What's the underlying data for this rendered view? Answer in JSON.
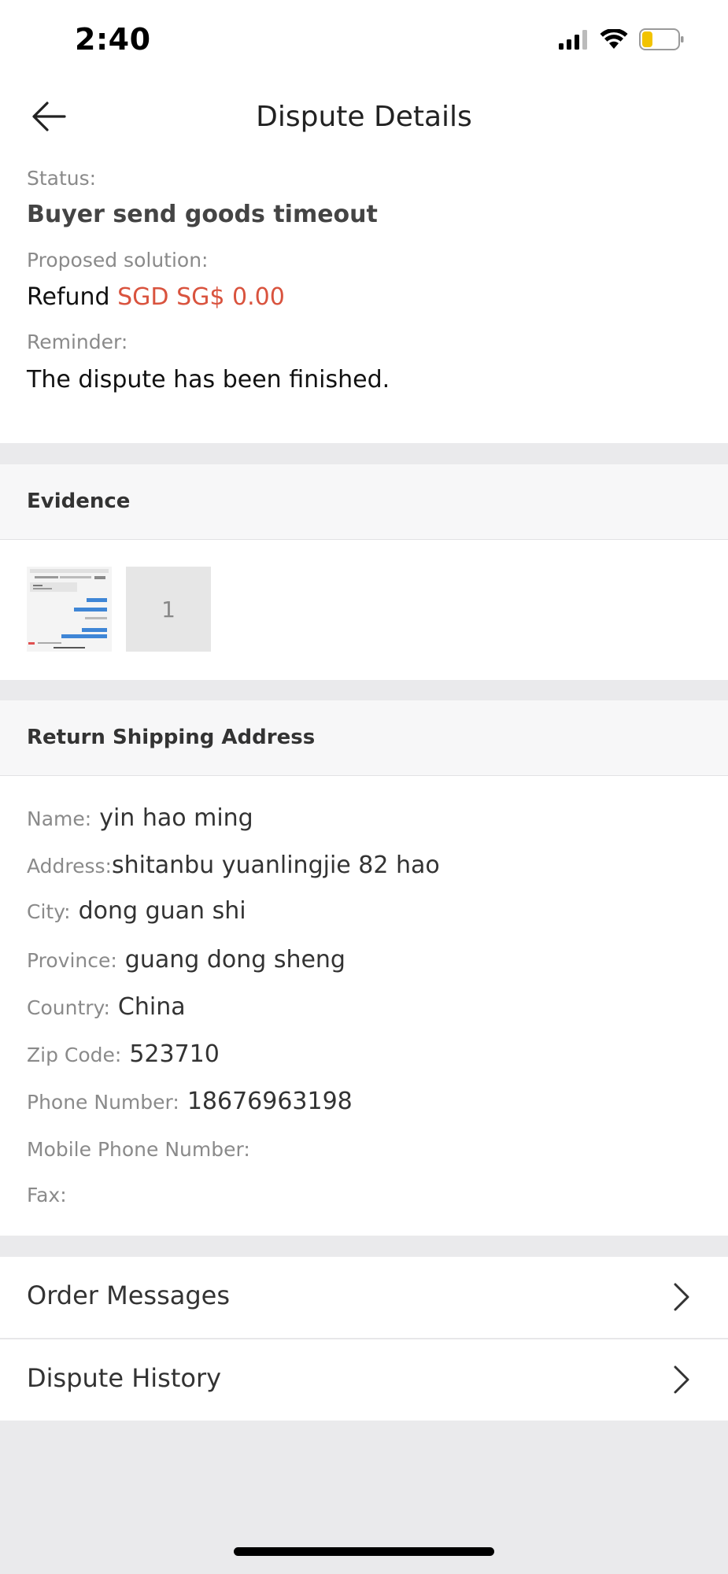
{
  "status_bar": {
    "time": "2:40",
    "icons": [
      "cellular-signal-icon",
      "wifi-icon",
      "battery-icon"
    ],
    "battery_color": "#f2c300"
  },
  "header": {
    "title": "Dispute Details",
    "back_icon": "arrow-left-icon"
  },
  "summary": {
    "status_label": "Status:",
    "status_value": "Buyer send goods timeout",
    "solution_label": "Proposed solution:",
    "solution_prefix": "Refund",
    "solution_amount": "SGD SG$ 0.00",
    "reminder_label": "Reminder:",
    "reminder_value": "The dispute has been finished."
  },
  "evidence": {
    "title": "Evidence",
    "images": [
      {
        "kind": "screenshot-thumbnail"
      },
      {
        "kind": "placeholder",
        "label": "1"
      }
    ]
  },
  "address": {
    "title": "Return Shipping Address",
    "fields": [
      {
        "label": "Name:",
        "value": "yin hao ming"
      },
      {
        "label": "Address:",
        "value": "shitanbu yuanlingjie 82 hao"
      },
      {
        "label": "City:",
        "value": "dong guan shi"
      },
      {
        "label": "Province:",
        "value": "guang dong sheng"
      },
      {
        "label": "Country:",
        "value": "China"
      },
      {
        "label": "Zip Code:",
        "value": "523710"
      },
      {
        "label": "Phone Number:",
        "value": "18676963198"
      },
      {
        "label": "Mobile Phone Number:",
        "value": ""
      },
      {
        "label": "Fax:",
        "value": ""
      }
    ]
  },
  "nav": {
    "order_messages": "Order Messages",
    "dispute_history": "Dispute History",
    "chevron_icon": "chevron-right-icon"
  },
  "colors": {
    "accent_red": "#d9533e",
    "background": "#eaeaec"
  }
}
